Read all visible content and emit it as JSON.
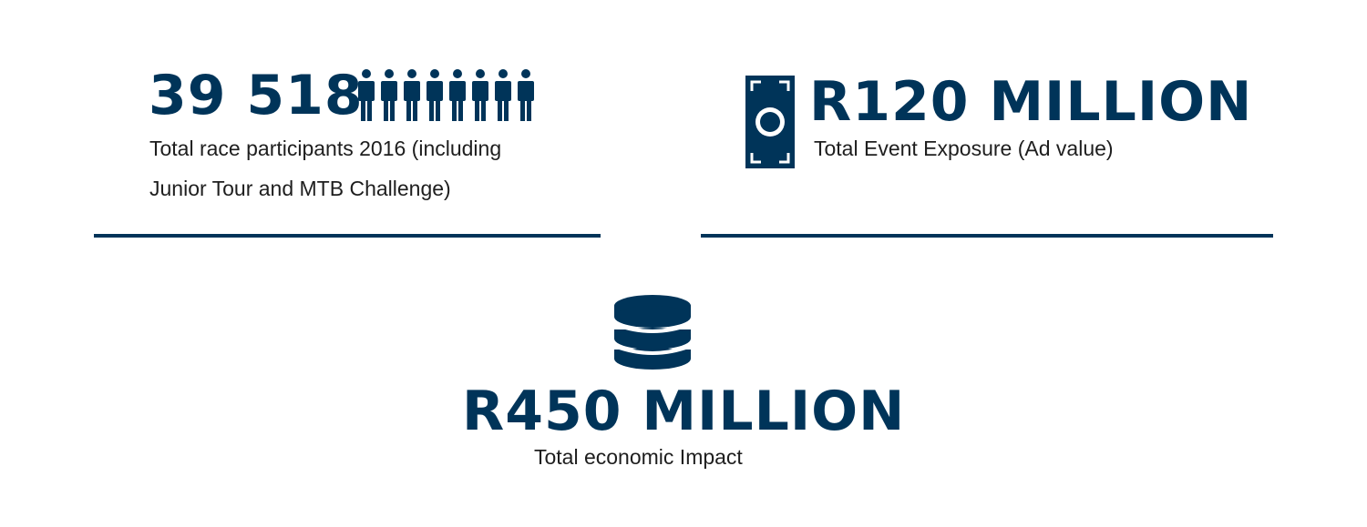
{
  "colors": {
    "accent": "#003459",
    "caption_text": "#1e1e1e",
    "background": "#ffffff"
  },
  "participants": {
    "value": "39 518",
    "icon": "people-icon",
    "caption_line1": "Total race participants 2016 (including",
    "caption_line2": "Junior Tour and MTB Challenge)"
  },
  "exposure": {
    "value": "R120 MILLION",
    "icon": "banknote-icon",
    "caption": "Total Event Exposure (Ad value)"
  },
  "economic": {
    "value": "R450 MILLION",
    "icon": "coin-stack-icon",
    "caption": "Total economic Impact"
  }
}
